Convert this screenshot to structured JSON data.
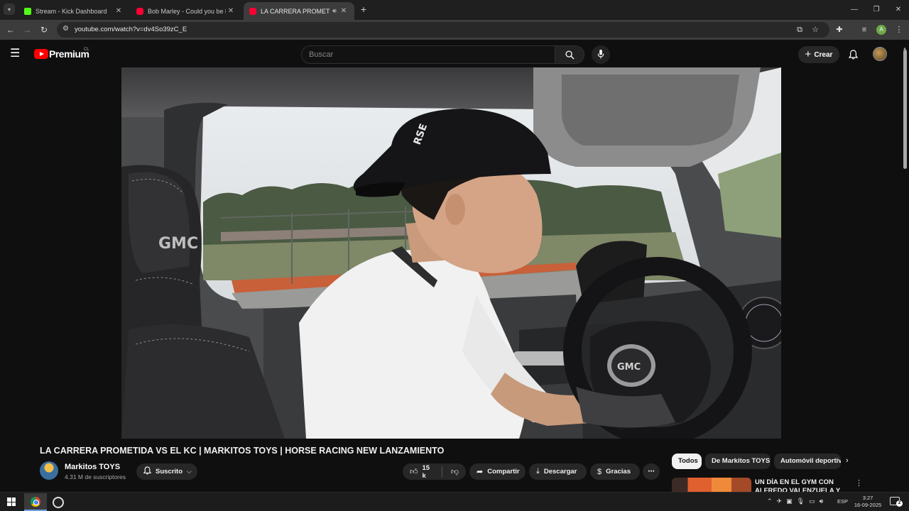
{
  "browser": {
    "tabs": [
      {
        "title": "Stream - Kick Dashboard",
        "favicon_color": "#53fc18"
      },
      {
        "title": "Bob Marley - Could you be loved",
        "favicon_color": "#ff0033"
      },
      {
        "title": "LA CARRERA PROMETIDA VS EL KC | MARKITOS TOYS | HORSE RACING NEW LANZAMIENTO",
        "favicon_color": "#ff0033"
      }
    ],
    "url": "youtube.com/watch?v=dv4So39zC_E"
  },
  "masthead": {
    "brand": "Premium",
    "country": "CL",
    "search_placeholder": "Buscar",
    "create_label": "Crear"
  },
  "video": {
    "title": "LA CARRERA PROMETIDA VS EL KC | MARKITOS TOYS | HORSE RACING NEW LANZAMIENTO",
    "seat_badge": "GMC",
    "wheel_badge": "GMC",
    "cap_text": "RSE"
  },
  "channel": {
    "name": "Markitos TOYS",
    "subscribers": "4.31 M de suscriptores",
    "subscribed_label": "Suscrito"
  },
  "actions": {
    "likes": "15 k",
    "share_label": "Compartir",
    "download_label": "Descargar",
    "thanks_label": "Gracias"
  },
  "chips": [
    "Todos",
    "De Markitos TOYS",
    "Automóvil deportivo"
  ],
  "recommendation": {
    "title": "UN DÍA EN EL GYM CON ALFREDO VALENZUELA Y MI"
  },
  "taskbar": {
    "language": "ESP",
    "time": "3:27",
    "date": "16-09-2025",
    "notifications": "2"
  },
  "colors": {
    "yt_red": "#ff0000",
    "background": "#0f0f0f",
    "pill_bg": "#272727"
  }
}
